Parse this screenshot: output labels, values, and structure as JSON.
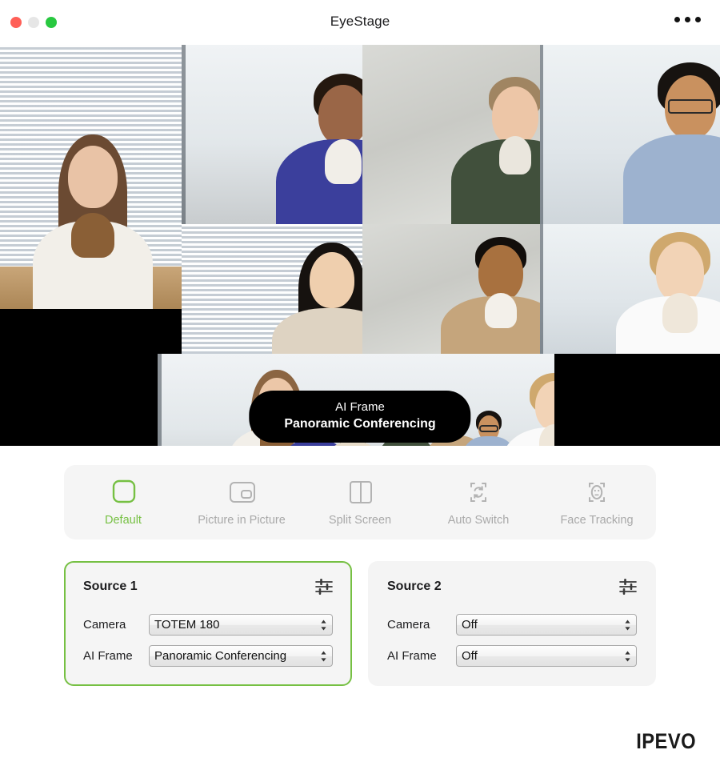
{
  "window": {
    "title": "EyeStage",
    "traffic_lights": [
      {
        "name": "close",
        "color": "#ff5f57"
      },
      {
        "name": "minimize",
        "color": "#e6e6e6"
      },
      {
        "name": "maximize",
        "color": "#28c840"
      }
    ],
    "more_menu_icon": "ellipsis-icon"
  },
  "stage": {
    "overlay_pill": {
      "top_label": "AI Frame",
      "main_label": "Panoramic Conferencing"
    },
    "letterbox_color": "#000000",
    "tiles": [
      {
        "name": "participant-tile-1",
        "position": "top-left"
      },
      {
        "name": "participant-tile-2",
        "position": "top-center"
      },
      {
        "name": "participant-tile-3",
        "position": "top-right"
      },
      {
        "name": "participant-tile-4",
        "position": "mid-left"
      },
      {
        "name": "participant-tile-5",
        "position": "mid-center"
      },
      {
        "name": "participant-tile-6",
        "position": "mid-right"
      },
      {
        "name": "panoramic-strip",
        "position": "bottom"
      }
    ]
  },
  "modes": {
    "accent_color": "#76c043",
    "inactive_color": "#a9a9a9",
    "items": [
      {
        "label": "Default",
        "icon": "default-frame-icon",
        "active": true
      },
      {
        "label": "Picture in Picture",
        "icon": "picture-in-picture-icon",
        "active": false
      },
      {
        "label": "Split Screen",
        "icon": "split-screen-icon",
        "active": false
      },
      {
        "label": "Auto Switch",
        "icon": "auto-switch-icon",
        "active": false
      },
      {
        "label": "Face Tracking",
        "icon": "face-tracking-icon",
        "active": false
      }
    ]
  },
  "sources": [
    {
      "title": "Source 1",
      "selected": true,
      "settings_icon": "sliders-icon",
      "rows": [
        {
          "label": "Camera",
          "value": "TOTEM 180"
        },
        {
          "label": "AI Frame",
          "value": "Panoramic Conferencing"
        }
      ]
    },
    {
      "title": "Source 2",
      "selected": false,
      "settings_icon": "sliders-icon",
      "rows": [
        {
          "label": "Camera",
          "value": "Off"
        },
        {
          "label": "AI Frame",
          "value": "Off"
        }
      ]
    }
  ],
  "footer": {
    "brand": "IPEVO"
  }
}
